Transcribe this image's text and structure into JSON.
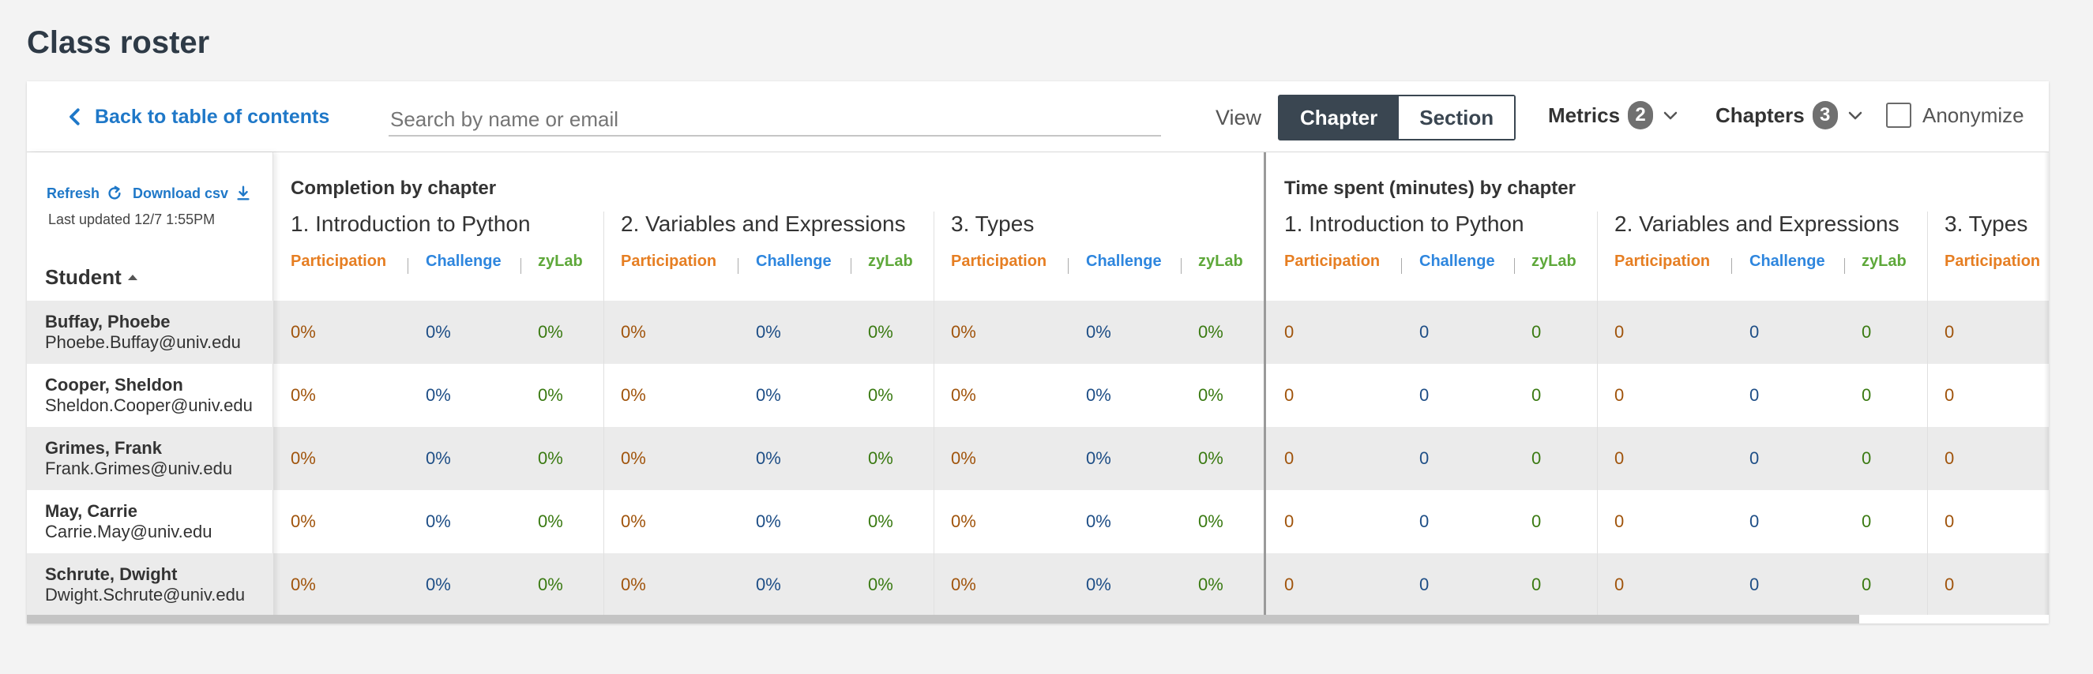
{
  "page": {
    "title": "Class roster"
  },
  "toolbar": {
    "back_label": "Back to table of contents",
    "search_placeholder": "Search by name or email",
    "view_label": "View",
    "view_options": [
      "Chapter",
      "Section"
    ],
    "view_selected": "Chapter",
    "metrics_label": "Metrics",
    "metrics_count": "2",
    "chapters_label": "Chapters",
    "chapters_count": "3",
    "anonymize_label": "Anonymize",
    "anonymize_checked": false
  },
  "sidebar": {
    "refresh_label": "Refresh",
    "download_label": "Download csv",
    "last_updated": "Last updated 12/7 1:55PM",
    "student_header": "Student"
  },
  "groups": [
    {
      "title": "Completion by chapter",
      "chapters": [
        "1. Introduction to Python",
        "2. Variables and Expressions",
        "3. Types"
      ],
      "columns": [
        "Participation",
        "Challenge",
        "zyLab"
      ]
    },
    {
      "title": "Time spent (minutes) by chapter",
      "chapters": [
        "1. Introduction to Python",
        "2. Variables and Expressions",
        "3. Types"
      ],
      "columns": [
        "Participation",
        "Challenge",
        "zyLab"
      ]
    }
  ],
  "students": [
    {
      "name": "Buffay, Phoebe",
      "email": "Phoebe.Buffay@univ.edu",
      "completion": [
        "0%",
        "0%",
        "0%",
        "0%",
        "0%",
        "0%",
        "0%",
        "0%",
        "0%"
      ],
      "time": [
        "0",
        "0",
        "0",
        "0",
        "0",
        "0",
        "0"
      ]
    },
    {
      "name": "Cooper, Sheldon",
      "email": "Sheldon.Cooper@univ.edu",
      "completion": [
        "0%",
        "0%",
        "0%",
        "0%",
        "0%",
        "0%",
        "0%",
        "0%",
        "0%"
      ],
      "time": [
        "0",
        "0",
        "0",
        "0",
        "0",
        "0",
        "0"
      ]
    },
    {
      "name": "Grimes, Frank",
      "email": "Frank.Grimes@univ.edu",
      "completion": [
        "0%",
        "0%",
        "0%",
        "0%",
        "0%",
        "0%",
        "0%",
        "0%",
        "0%"
      ],
      "time": [
        "0",
        "0",
        "0",
        "0",
        "0",
        "0",
        "0"
      ]
    },
    {
      "name": "May, Carrie",
      "email": "Carrie.May@univ.edu",
      "completion": [
        "0%",
        "0%",
        "0%",
        "0%",
        "0%",
        "0%",
        "0%",
        "0%",
        "0%"
      ],
      "time": [
        "0",
        "0",
        "0",
        "0",
        "0",
        "0",
        "0"
      ]
    },
    {
      "name": "Schrute, Dwight",
      "email": "Dwight.Schrute@univ.edu",
      "completion": [
        "0%",
        "0%",
        "0%",
        "0%",
        "0%",
        "0%",
        "0%",
        "0%",
        "0%"
      ],
      "time": [
        "0",
        "0",
        "0",
        "0",
        "0",
        "0",
        "0"
      ]
    }
  ],
  "colors": {
    "participation": "#e67e22",
    "challenge": "#2e86de",
    "zylab": "#5ea83a",
    "link": "#1f78c8",
    "segment_active": "#3a4651"
  },
  "icons": {
    "back": "chevron-left-icon",
    "refresh": "refresh-icon",
    "download": "download-icon",
    "sort": "sort-ascending-icon",
    "dropdown": "chevron-down-icon"
  }
}
